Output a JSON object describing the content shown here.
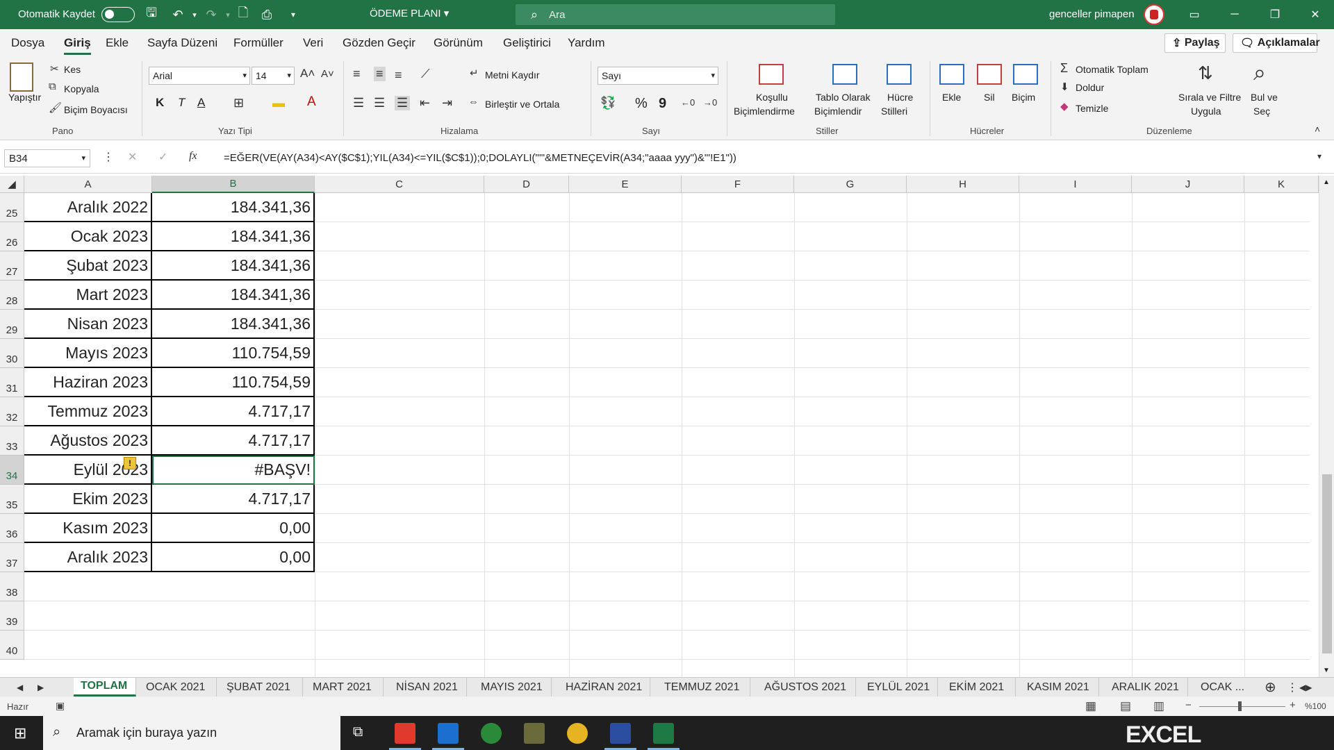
{
  "titlebar": {
    "autosave_label": "Otomatik Kaydet",
    "document_title": "ÖDEME PLANI",
    "search_placeholder": "Ara",
    "user_name": "genceller pimapen"
  },
  "menu_tabs": [
    "Dosya",
    "Giriş",
    "Ekle",
    "Sayfa Düzeni",
    "Formüller",
    "Veri",
    "Gözden Geçir",
    "Görünüm",
    "Geliştirici",
    "Yardım"
  ],
  "active_tab": "Giriş",
  "share_label": "Paylaş",
  "comments_label": "Açıklamalar",
  "ribbon": {
    "pano": {
      "paste": "Yapıştır",
      "cut": "Kes",
      "copy": "Kopyala",
      "format_painter": "Biçim Boyacısı",
      "label": "Pano"
    },
    "font": {
      "family": "Arial",
      "size": "14",
      "bold": "K",
      "italic": "T",
      "underline": "A",
      "label": "Yazı Tipi"
    },
    "alignment": {
      "wrap": "Metni Kaydır",
      "merge": "Birleştir ve Ortala",
      "label": "Hizalama"
    },
    "number": {
      "format": "Sayı",
      "percent": "%",
      "comma": "9",
      "label": "Sayı"
    },
    "styles": {
      "conditional_line1": "Koşullu",
      "conditional_line2": "Biçimlendirme",
      "table_line1": "Tablo Olarak",
      "table_line2": "Biçimlendir",
      "cell_line1": "Hücre",
      "cell_line2": "Stilleri",
      "label": "Stiller"
    },
    "cells": {
      "insert": "Ekle",
      "delete": "Sil",
      "format": "Biçim",
      "label": "Hücreler"
    },
    "editing": {
      "autosum": "Otomatik Toplam",
      "fill": "Doldur",
      "clear": "Temizle",
      "sort_line1": "Sırala ve Filtre",
      "sort_line2": "Uygula",
      "find_line1": "Bul ve",
      "find_line2": "Seç",
      "label": "Düzenleme"
    }
  },
  "formula_bar": {
    "name_box": "B34",
    "fx": "fx",
    "formula": "=EĞER(VE(AY(A34)<AY($C$1);YIL(A34)<=YIL($C$1));0;DOLAYLI(\"'\"&METNEÇEVİR(A34;\"aaaa yyy\")&\"'!E1\"))"
  },
  "columns": [
    "A",
    "B",
    "C",
    "D",
    "E",
    "F",
    "G",
    "H",
    "I",
    "J",
    "K"
  ],
  "selected_column": "B",
  "rows": [
    {
      "num": "25",
      "a": "Aralık 2022",
      "b": "184.341,36"
    },
    {
      "num": "26",
      "a": "Ocak 2023",
      "b": "184.341,36"
    },
    {
      "num": "27",
      "a": "Şubat 2023",
      "b": "184.341,36"
    },
    {
      "num": "28",
      "a": "Mart 2023",
      "b": "184.341,36"
    },
    {
      "num": "29",
      "a": "Nisan 2023",
      "b": "184.341,36"
    },
    {
      "num": "30",
      "a": "Mayıs 2023",
      "b": "110.754,59"
    },
    {
      "num": "31",
      "a": "Haziran 2023",
      "b": "110.754,59"
    },
    {
      "num": "32",
      "a": "Temmuz 2023",
      "b": "4.717,17"
    },
    {
      "num": "33",
      "a": "Ağustos 2023",
      "b": "4.717,17"
    },
    {
      "num": "34",
      "a": "Eylül 2023",
      "b": "#BAŞV!"
    },
    {
      "num": "35",
      "a": "Ekim 2023",
      "b": "4.717,17"
    },
    {
      "num": "36",
      "a": "Kasım 2023",
      "b": "0,00"
    },
    {
      "num": "37",
      "a": "Aralık 2023",
      "b": "0,00"
    },
    {
      "num": "38",
      "a": "",
      "b": ""
    },
    {
      "num": "39",
      "a": "",
      "b": ""
    },
    {
      "num": "40",
      "a": "",
      "b": ""
    }
  ],
  "sheet_tabs": [
    "TOPLAM",
    "OCAK 2021",
    "ŞUBAT 2021",
    "MART 2021",
    "NİSAN 2021",
    "MAYIS 2021",
    "HAZİRAN 2021",
    "TEMMUZ 2021",
    "AĞUSTOS 2021",
    "EYLÜL 2021",
    "EKİM 2021",
    "KASIM 2021",
    "ARALIK 2021",
    "OCAK ..."
  ],
  "active_sheet": "TOPLAM",
  "status": {
    "ready": "Hazır",
    "zoom": "%100"
  },
  "taskbar": {
    "search_placeholder": "Aramak için buraya yazın"
  },
  "brand": "EXCEL",
  "colors": {
    "accent": "#217346",
    "warning": "#f0c33c"
  }
}
